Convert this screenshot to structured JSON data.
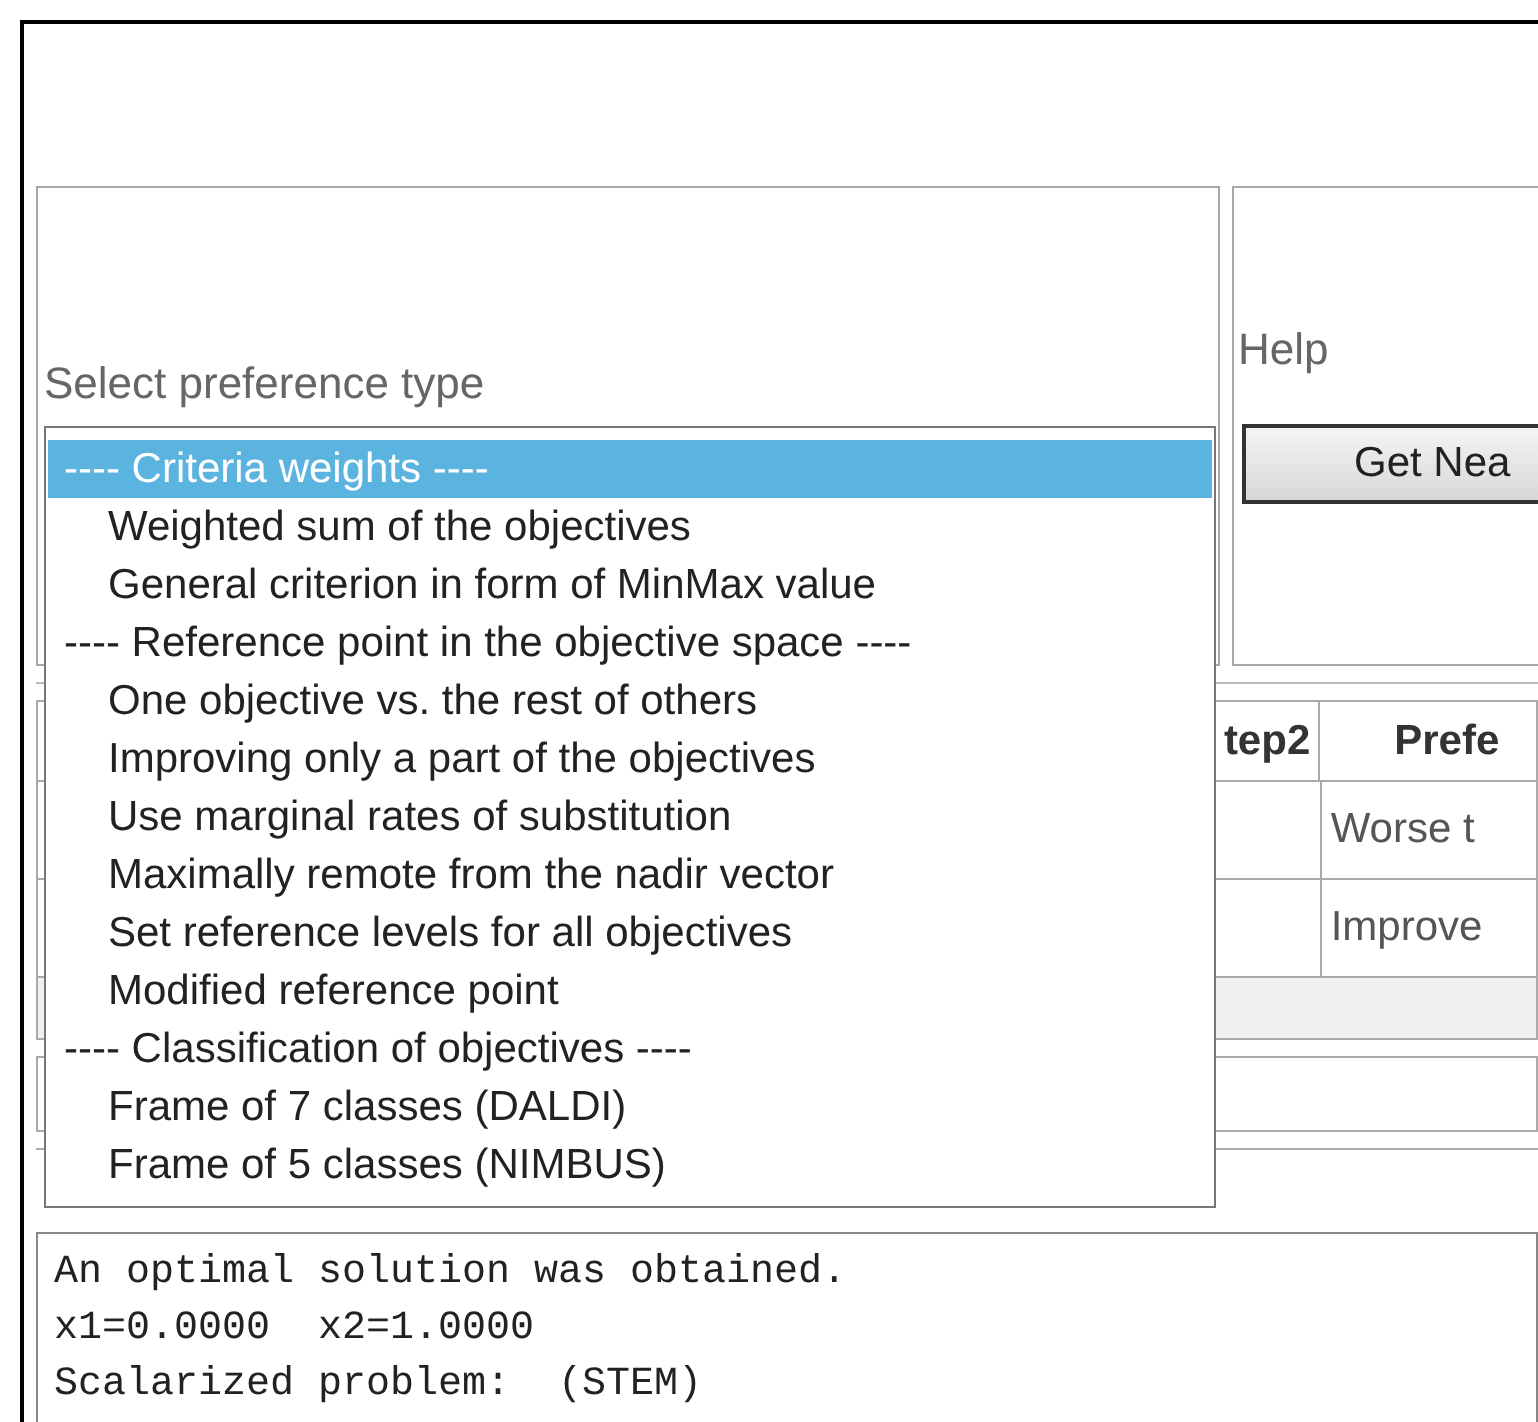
{
  "preference_panel": {
    "label": "Select preference type"
  },
  "help_panel": {
    "label": "Help",
    "button": "Get Nea"
  },
  "preference_list": [
    {
      "kind": "group",
      "label": "---- Criteria weights ----",
      "selected": true
    },
    {
      "kind": "option",
      "label": "Weighted sum of the objectives",
      "selected": false
    },
    {
      "kind": "option",
      "label": "General criterion in form of MinMax value",
      "selected": false
    },
    {
      "kind": "group",
      "label": "---- Reference point in the objective space ----",
      "selected": false
    },
    {
      "kind": "option",
      "label": "One objective vs. the rest of others",
      "selected": false
    },
    {
      "kind": "option",
      "label": "Improving only a part of the objectives",
      "selected": false
    },
    {
      "kind": "option",
      "label": "Use marginal rates of substitution",
      "selected": false
    },
    {
      "kind": "option",
      "label": "Maximally remote from the nadir vector",
      "selected": false
    },
    {
      "kind": "option",
      "label": "Set reference levels for all objectives",
      "selected": false
    },
    {
      "kind": "option",
      "label": "Modified reference point",
      "selected": false
    },
    {
      "kind": "group",
      "label": "---- Classification of objectives ----",
      "selected": false
    },
    {
      "kind": "option",
      "label": "Frame of 7 classes (DALDI)",
      "selected": false
    },
    {
      "kind": "option",
      "label": "Frame of 5 classes (NIMBUS)",
      "selected": false
    }
  ],
  "table": {
    "columns": [
      "tep2",
      "Prefe"
    ],
    "rows": [
      "Worse t",
      "Improve"
    ]
  },
  "result": {
    "lines": [
      "An optimal solution was obtained.",
      "x1=0.0000  x2=1.0000",
      "Scalarized problem:  (STEM)"
    ]
  }
}
